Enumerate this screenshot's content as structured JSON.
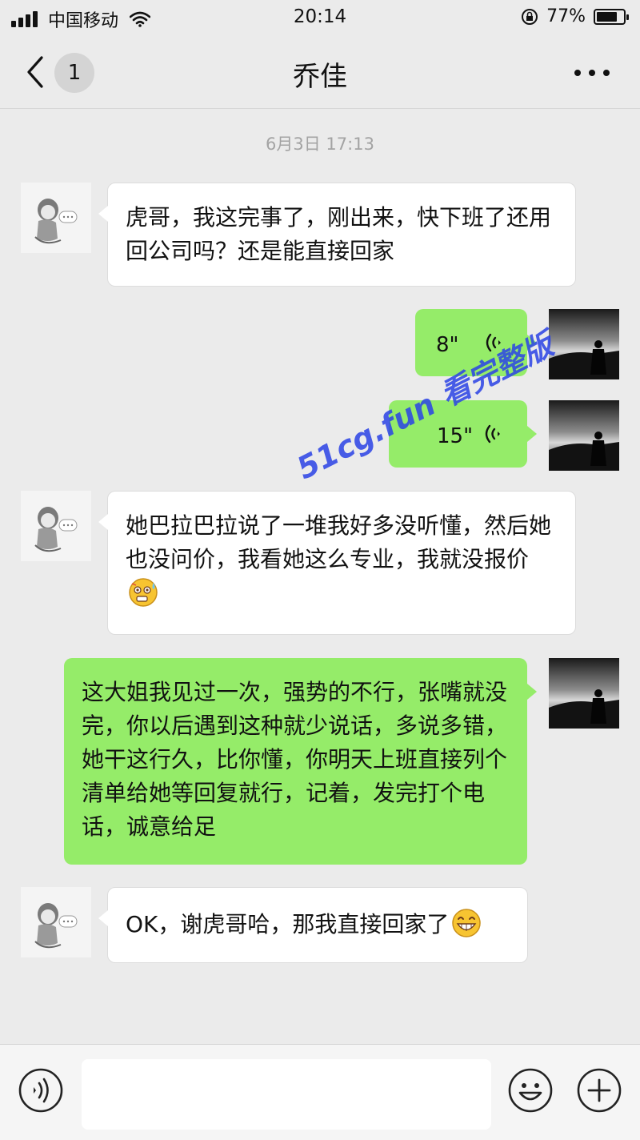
{
  "status_bar": {
    "carrier": "中国移动",
    "time": "20:14",
    "battery": "77%",
    "battery_level": 0.77
  },
  "nav": {
    "unread_count": "1",
    "title": "乔佳"
  },
  "timestamp": "6月3日 17:13",
  "messages": [
    {
      "side": "in",
      "type": "text",
      "text": "虎哥，我这完事了，刚出来，快下班了还用回公司吗？还是能直接回家"
    },
    {
      "side": "out",
      "type": "voice",
      "duration": "8\""
    },
    {
      "side": "out",
      "type": "voice",
      "duration": "15\""
    },
    {
      "side": "in",
      "type": "text",
      "text": "她巴拉巴拉说了一堆我好多没听懂，然后她也没问价，我看她这么专业，我就没报价",
      "emoji": "anxious-sweat-emoji"
    },
    {
      "side": "out",
      "type": "text",
      "text": "这大姐我见过一次，强势的不行，张嘴就没完，你以后遇到这种就少说话，多说多错，她干这行久，比你懂，你明天上班直接列个清单给她等回复就行，记着，发完打个电话，诚意给足"
    },
    {
      "side": "in",
      "type": "text",
      "text": "OK，谢虎哥哈，那我直接回家了",
      "emoji": "grin-emoji"
    }
  ],
  "watermark": "51cg.fun 看完整版",
  "colors": {
    "background": "#ebebeb",
    "incoming_bubble": "#ffffff",
    "outgoing_bubble": "#95ec69",
    "timestamp": "#a3a3a3",
    "watermark": "#2b43e6"
  },
  "input_bar": {
    "left_icon": "voice-icon",
    "right_icons": [
      "emoji-icon",
      "plus-icon"
    ]
  }
}
